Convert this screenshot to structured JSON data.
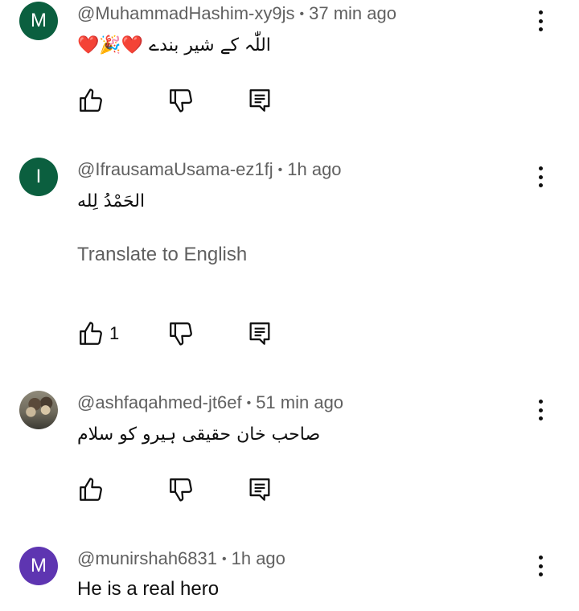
{
  "comments": [
    {
      "avatar_letter": "M",
      "avatar_color": "#0b5f3f",
      "handle": "@MuhammadHashim-xy9js",
      "time": "37 min ago",
      "text": "❤️🎉❤️ اللّٰہ کے شیر بندے",
      "like_count": ""
    },
    {
      "avatar_letter": "I",
      "avatar_color": "#0b5f3f",
      "handle": "@IfrausamaUsama-ez1fj",
      "time": "1h ago",
      "text": "الحَمْدُ لِله",
      "translate": "Translate to English",
      "like_count": "1"
    },
    {
      "avatar_letter": "",
      "handle": "@ashfaqahmed-jt6ef",
      "time": "51 min ago",
      "text": "صاحب خان حقیقی ہیرو کو سلام",
      "like_count": ""
    },
    {
      "avatar_letter": "M",
      "avatar_color": "#5e35b1",
      "handle": "@munirshah6831",
      "time": "1h ago",
      "text": "He is a real hero",
      "like_count": ""
    }
  ],
  "separator": "•"
}
